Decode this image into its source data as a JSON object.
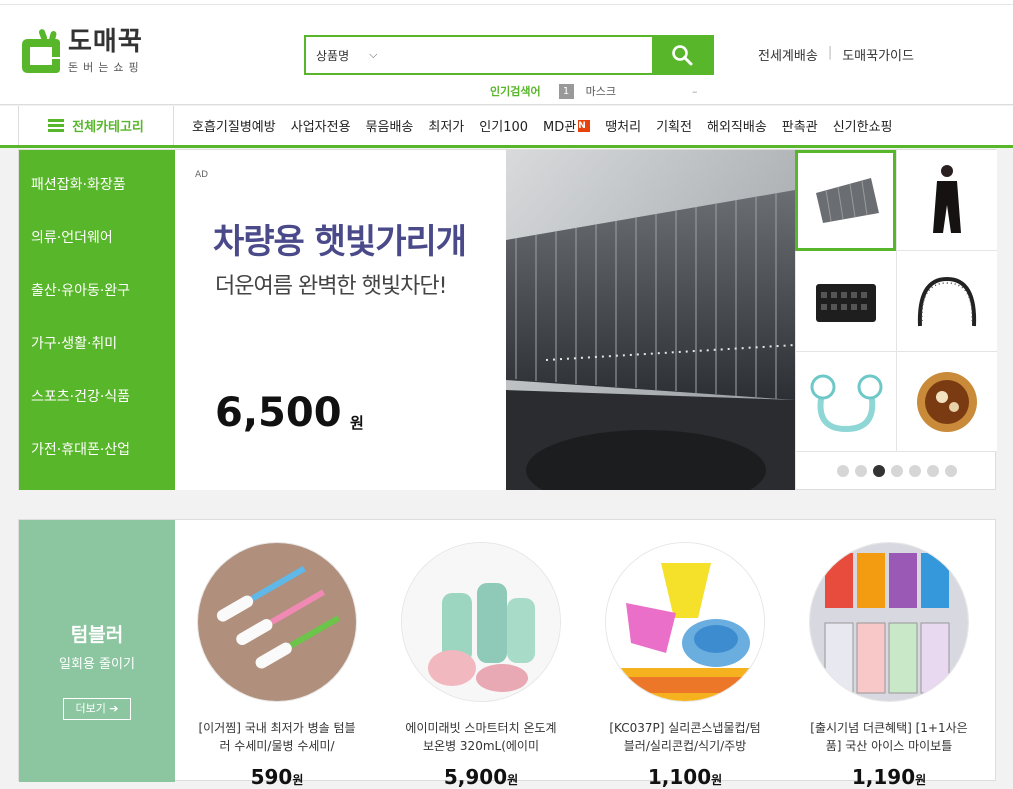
{
  "colors": {
    "accent": "#58b62a",
    "section_side": "#8cc6a0",
    "badge_new": "#e8420c"
  },
  "logo": {
    "title": "도매꾹",
    "subtitle": "돈버는쇼핑"
  },
  "search": {
    "category": "상품명",
    "placeholder": ""
  },
  "popular": {
    "label": "인기검색어",
    "rank": "1",
    "keyword": "마스크",
    "dash": "–"
  },
  "toplinks": {
    "global_shipping": "전세계배송",
    "guide": "도매꾹가이드"
  },
  "nav": {
    "all_categories": "전체카테고리",
    "items": [
      {
        "label": "호흡기질병예방"
      },
      {
        "label": "사업자전용"
      },
      {
        "label": "묶음배송"
      },
      {
        "label": "최저가"
      },
      {
        "label": "인기100"
      },
      {
        "label": "MD관",
        "badge": "N"
      },
      {
        "label": "땡처리"
      },
      {
        "label": "기획전"
      },
      {
        "label": "해외직배송"
      },
      {
        "label": "판촉관"
      },
      {
        "label": "신기한쇼핑"
      }
    ]
  },
  "sidebar": {
    "items": [
      {
        "label": "패션잡화·화장품"
      },
      {
        "label": "의류·언더웨어"
      },
      {
        "label": "출산·유아동·완구"
      },
      {
        "label": "가구·생활·취미"
      },
      {
        "label": "스포츠·건강·식품"
      },
      {
        "label": "가전·휴대폰·산업"
      }
    ]
  },
  "banner": {
    "ad_tag": "AD",
    "title": "차량용 햇빛가리개",
    "subtitle": "더운여름 완벽한 햇빛차단!",
    "price": "6,500",
    "currency": "원",
    "active_slide": 3,
    "slide_count": 7
  },
  "thumbs": [
    {
      "icon": "sunshade-icon"
    },
    {
      "icon": "dress-icon"
    },
    {
      "icon": "basket-icon"
    },
    {
      "icon": "headband-icon"
    },
    {
      "icon": "neck-fan-icon"
    },
    {
      "icon": "food-icon"
    }
  ],
  "section": {
    "title": "텀블러",
    "subtitle": "일회용 줄이기",
    "more": "더보기 ➔",
    "products": [
      {
        "name": "[이거찜] 국내 최저가 병솔 텀블러 수세미/물병 수세미/",
        "price": "590",
        "currency": "원"
      },
      {
        "name": "에이미래빗 스마트터치 온도계 보온병 320mL(에이미",
        "price": "5,900",
        "currency": "원"
      },
      {
        "name": "[KC037P] 실리콘스냅물컵/텀블러/실리콘컵/식기/주방",
        "price": "1,100",
        "currency": "원"
      },
      {
        "name": "[출시기념 더큰혜택] [1+1사은품] 국산 아이스 마이보틀",
        "price": "1,190",
        "currency": "원"
      }
    ]
  }
}
